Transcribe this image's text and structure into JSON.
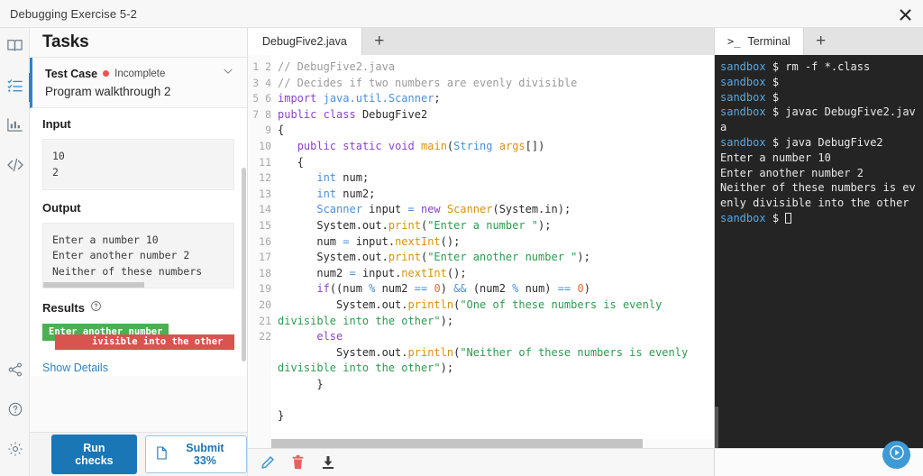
{
  "window": {
    "title": "Debugging Exercise 5-2",
    "close_icon": "close-icon"
  },
  "rail": {
    "items": [
      {
        "icon": "book-icon",
        "name": "instructions",
        "active": false
      },
      {
        "icon": "checklist-icon",
        "name": "tasks",
        "active": true
      },
      {
        "icon": "bar-chart-icon",
        "name": "grades",
        "active": false
      },
      {
        "icon": "code-brackets-icon",
        "name": "code",
        "active": false
      }
    ],
    "bottom_items": [
      {
        "icon": "share-icon",
        "name": "share"
      },
      {
        "icon": "help-circle-icon",
        "name": "help"
      },
      {
        "icon": "gear-icon",
        "name": "settings"
      }
    ]
  },
  "tasks": {
    "header": "Tasks",
    "test_case": {
      "label": "Test Case",
      "status": "Incomplete",
      "status_color": "#f2524f",
      "name": "Program walkthrough 2",
      "chevron_icon": "chevron-down-icon"
    },
    "input": {
      "title": "Input",
      "value": "10\n2"
    },
    "output": {
      "title": "Output",
      "value": "Enter a number 10\nEnter another number 2\nNeither of these numbers"
    },
    "results": {
      "title": "Results",
      "help_icon": "help-circle-icon",
      "badges": [
        {
          "text": "Enter another number",
          "type": "pass",
          "color": "#4caf50"
        },
        {
          "text": "ivisible into the other",
          "type": "fail",
          "color": "#d9534f"
        }
      ],
      "show_details": "Show Details"
    },
    "footer": {
      "run_checks": "Run checks",
      "submit": "Submit 33%",
      "submit_icon": "document-icon"
    }
  },
  "editor": {
    "tabs": [
      {
        "label": "DebugFive2.java",
        "active": true
      }
    ],
    "add_tab_icon": "plus-icon",
    "line_numbers": [
      1,
      2,
      3,
      4,
      5,
      6,
      7,
      8,
      9,
      10,
      11,
      12,
      13,
      14,
      15,
      16,
      17,
      18,
      19,
      20,
      21,
      22
    ],
    "code_lines": [
      "// DebugFive2.java",
      "// Decides if two numbers are evenly divisible",
      "import java.util.Scanner;",
      "public class DebugFive2",
      "{",
      "   public static void main(String args[])",
      "   {",
      "      int num;",
      "      int num2;",
      "      Scanner input = new Scanner(System.in);",
      "      System.out.print(\"Enter a number \");",
      "      num = input.nextInt();",
      "      System.out.print(\"Enter another number \");",
      "      num2 = input.nextInt();",
      "      if((num % num2 == 0) && (num2 % num) == 0)",
      "         System.out.println(\"One of these numbers is evenly divisible into the other\");",
      "      else",
      "         System.out.println(\"Neither of these numbers is evenly divisible into the other\");",
      "      }",
      "",
      "}",
      ""
    ],
    "footer_icons": [
      {
        "name": "edit-pencil-icon",
        "color": "#3d9ad4"
      },
      {
        "name": "delete-trash-icon",
        "color": "#e8605d"
      },
      {
        "name": "download-icon",
        "color": "#3a3a3a"
      }
    ]
  },
  "terminal": {
    "tab_label": "Terminal",
    "tab_icon": "terminal-prompt-icon",
    "add_tab_icon": "plus-icon",
    "prompt": "sandbox",
    "symbol": "$",
    "lines": [
      {
        "type": "prompt",
        "command": "rm -f *.class"
      },
      {
        "type": "prompt",
        "command": ""
      },
      {
        "type": "prompt",
        "command": ""
      },
      {
        "type": "prompt",
        "command": "javac DebugFive2.java"
      },
      {
        "type": "prompt",
        "command": "java DebugFive2"
      },
      {
        "type": "output",
        "text": "Enter a number 10"
      },
      {
        "type": "output",
        "text": "Enter another number 2"
      },
      {
        "type": "output",
        "text": "Neither of these numbers is evenly divisible into the other"
      },
      {
        "type": "prompt-cursor",
        "command": ""
      }
    ],
    "run_button_icon": "play-icon",
    "run_button_color": "#3d9ad4"
  }
}
